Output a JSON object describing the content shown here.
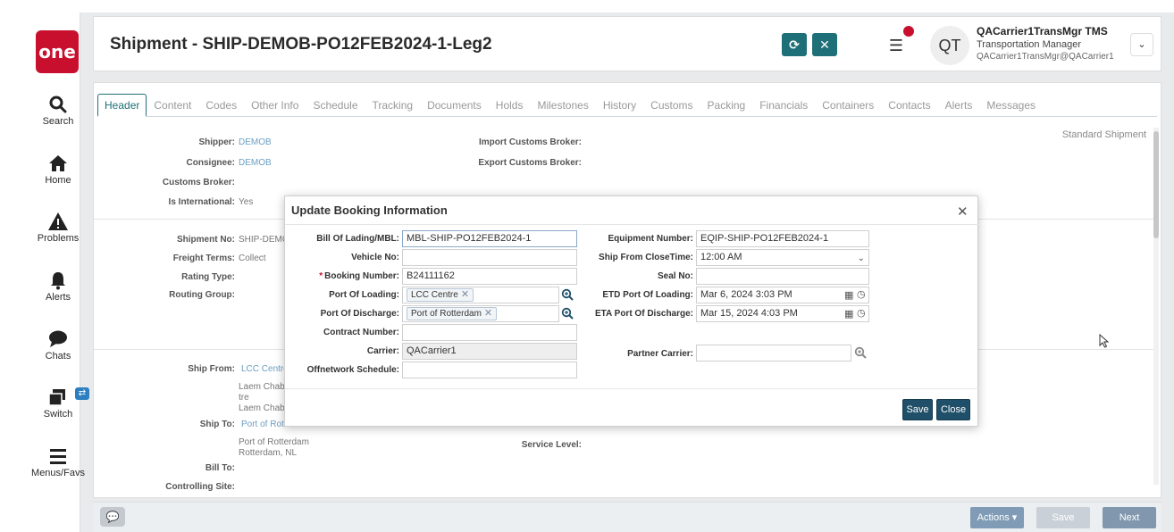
{
  "nav": {
    "logo": "one",
    "items": [
      {
        "label": "Search",
        "icon": "search-icon"
      },
      {
        "label": "Home",
        "icon": "home-icon"
      },
      {
        "label": "Problems",
        "icon": "warning-icon"
      },
      {
        "label": "Alerts",
        "icon": "bell-icon"
      },
      {
        "label": "Chats",
        "icon": "chat-icon"
      },
      {
        "label": "Switch",
        "icon": "switch-icon"
      },
      {
        "label": "Menus/Favs",
        "icon": "menu-icon"
      }
    ]
  },
  "header": {
    "title": "Shipment - SHIP-DEMOB-PO12FEB2024-1-Leg2",
    "user_initials": "QT",
    "user_name": "QACarrier1TransMgr TMS",
    "user_role": "Transportation Manager",
    "user_email": "QACarrier1TransMgr@QACarrier1"
  },
  "tabs": [
    "Header",
    "Content",
    "Codes",
    "Other Info",
    "Schedule",
    "Tracking",
    "Documents",
    "Holds",
    "Milestones",
    "History",
    "Customs",
    "Packing",
    "Financials",
    "Containers",
    "Contacts",
    "Alerts",
    "Messages"
  ],
  "background": {
    "shipment_type": "Standard Shipment",
    "shipper_label": "Shipper:",
    "shipper_value": "DEMOB",
    "consignee_label": "Consignee:",
    "consignee_value": "DEMOB",
    "customs_broker_label": "Customs Broker:",
    "is_international_label": "Is International:",
    "is_international_value": "Yes",
    "import_customs_broker_label": "Import Customs Broker:",
    "export_customs_broker_label": "Export Customs Broker:",
    "shipment_no_label": "Shipment No:",
    "shipment_no_value": "SHIP-DEMOE",
    "freight_terms_label": "Freight Terms:",
    "freight_terms_value": "Collect",
    "rating_type_label": "Rating Type:",
    "routing_group_label": "Routing Group:",
    "ship_from_label": "Ship From:",
    "ship_from_value": "LCC Centre",
    "ship_from_addr1": "Laem Chaba",
    "ship_from_addr2": "tre",
    "ship_from_addr3": "Laem Chaba",
    "ship_to_label": "Ship To:",
    "ship_to_value": "Port of Rott",
    "ship_to_addr1": "Port of Rotterdam",
    "ship_to_addr2": "Rotterdam, NL",
    "bill_to_label": "Bill To:",
    "controlling_site_label": "Controlling Site:",
    "service_level_label": "Service Level:"
  },
  "footer": {
    "actions_label": "Actions",
    "save_label": "Save",
    "next_label": "Next"
  },
  "modal": {
    "title": "Update Booking Information",
    "fields": {
      "bol_label": "Bill Of Lading/MBL:",
      "bol_value": "MBL-SHIP-PO12FEB2024-1",
      "vehicle_label": "Vehicle No:",
      "vehicle_value": "",
      "booking_label": "Booking Number:",
      "booking_value": "B24111162",
      "pol_label": "Port Of Loading:",
      "pol_value": "LCC Centre",
      "pod_label": "Port Of Discharge:",
      "pod_value": "Port of Rotterdam",
      "contract_label": "Contract Number:",
      "contract_value": "",
      "carrier_label": "Carrier:",
      "carrier_value": "QACarrier1",
      "offnetwork_label": "Offnetwork Schedule:",
      "offnetwork_value": "",
      "equipment_label": "Equipment Number:",
      "equipment_value": "EQIP-SHIP-PO12FEB2024-1",
      "closetime_label": "Ship From CloseTime:",
      "closetime_value": "12:00 AM",
      "seal_label": "Seal No:",
      "seal_value": "",
      "etd_label": "ETD Port Of Loading:",
      "etd_value": "Mar 6, 2024 3:03 PM",
      "eta_label": "ETA Port Of Discharge:",
      "eta_value": "Mar 15, 2024 4:03 PM",
      "partner_label": "Partner Carrier:",
      "partner_value": ""
    },
    "save_label": "Save",
    "close_label": "Close"
  }
}
